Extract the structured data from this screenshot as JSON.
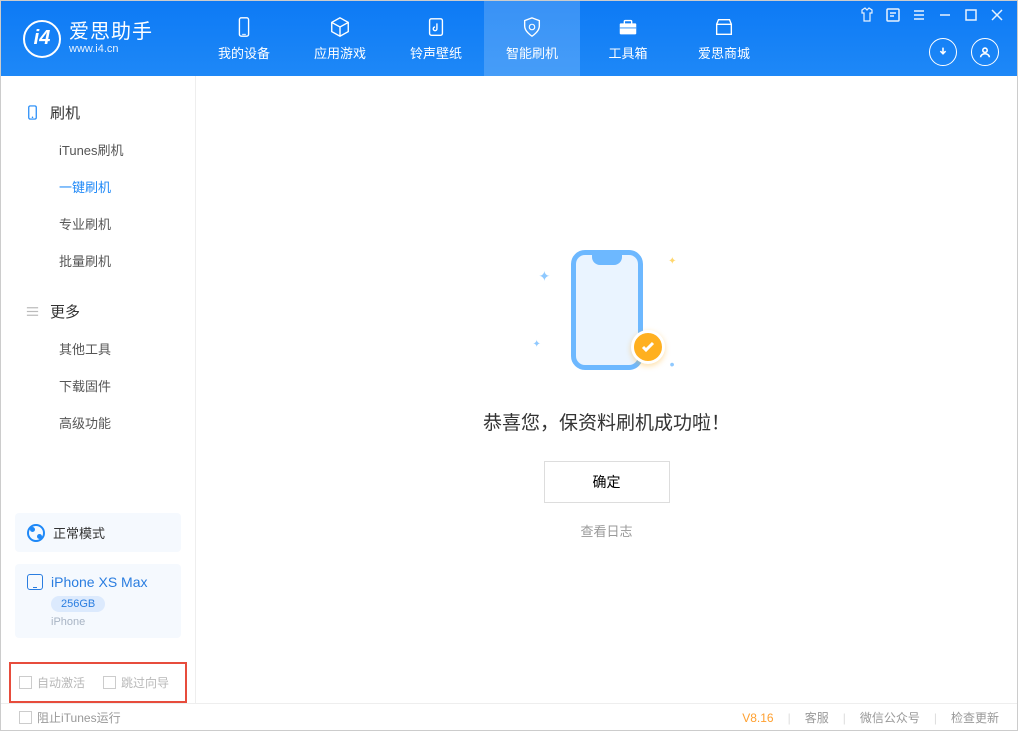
{
  "app": {
    "name": "爱思助手",
    "url": "www.i4.cn"
  },
  "nav": [
    {
      "label": "我的设备"
    },
    {
      "label": "应用游戏"
    },
    {
      "label": "铃声壁纸"
    },
    {
      "label": "智能刷机"
    },
    {
      "label": "工具箱"
    },
    {
      "label": "爱思商城"
    }
  ],
  "sidebar": {
    "section1": {
      "title": "刷机",
      "items": [
        "iTunes刷机",
        "一键刷机",
        "专业刷机",
        "批量刷机"
      ]
    },
    "section2": {
      "title": "更多",
      "items": [
        "其他工具",
        "下载固件",
        "高级功能"
      ]
    }
  },
  "mode": {
    "label": "正常模式"
  },
  "device": {
    "name": "iPhone XS Max",
    "storage": "256GB",
    "type": "iPhone"
  },
  "highlight": {
    "opt1": "自动激活",
    "opt2": "跳过向导"
  },
  "main": {
    "message": "恭喜您，保资料刷机成功啦！",
    "ok": "确定",
    "log": "查看日志"
  },
  "footer": {
    "block_itunes": "阻止iTunes运行",
    "version": "V8.16",
    "links": [
      "客服",
      "微信公众号",
      "检查更新"
    ]
  }
}
